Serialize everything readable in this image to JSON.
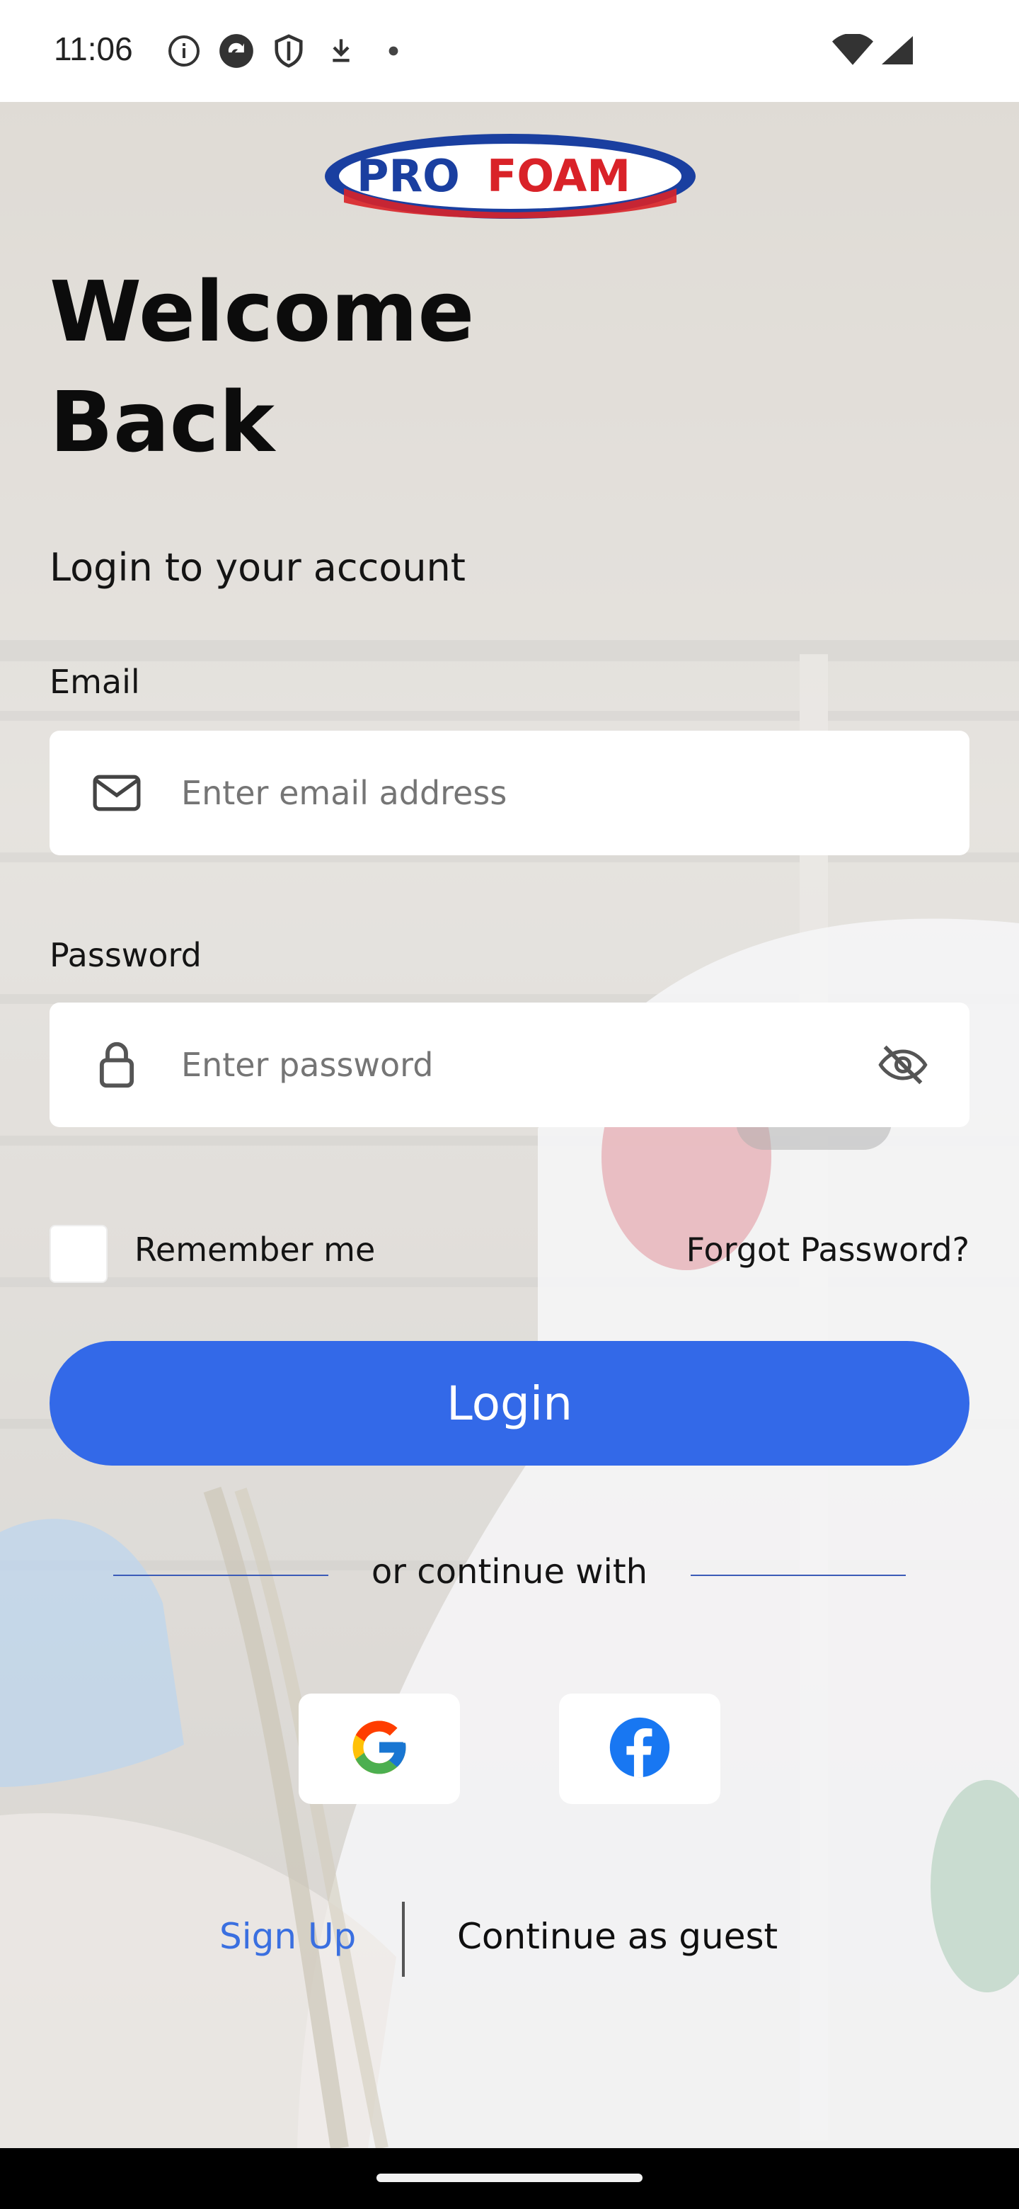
{
  "status_bar": {
    "time": "11:06",
    "left_icons": [
      "info-icon",
      "sync-icon",
      "shield-icon",
      "download-icon",
      "dot-icon"
    ],
    "right_icons": [
      "wifi-icon",
      "signal-icon"
    ]
  },
  "brand": {
    "logo_text_left": "PRO",
    "logo_text_right": "FOAM",
    "logo_colors": {
      "blue": "#1a3fa0",
      "red": "#d92228"
    }
  },
  "header": {
    "welcome_line1": "Welcome",
    "welcome_line2": "Back",
    "subtitle": "Login to your account"
  },
  "form": {
    "email_label": "Email",
    "email_placeholder": "Enter email address",
    "email_value": "",
    "password_label": "Password",
    "password_placeholder": "Enter password",
    "password_value": "",
    "remember_label": "Remember me",
    "remember_checked": false,
    "forgot_label": "Forgot Password?",
    "login_label": "Login"
  },
  "social": {
    "divider_text": "or continue with",
    "providers": [
      "google-icon",
      "facebook-icon"
    ]
  },
  "footer": {
    "signup_label": "Sign Up",
    "guest_label": "Continue as guest"
  },
  "colors": {
    "primary": "#3369e8",
    "link": "#3a6fe0"
  }
}
